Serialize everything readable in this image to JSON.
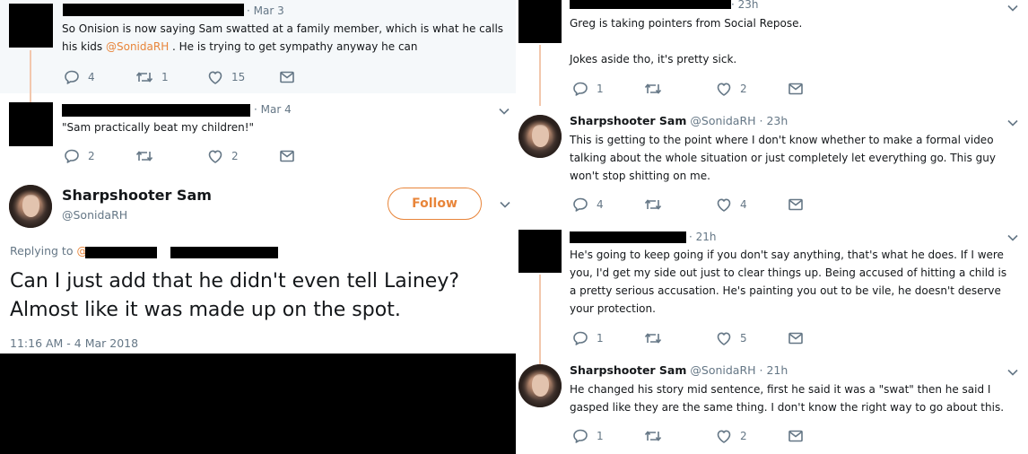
{
  "left": {
    "tweet1": {
      "time": "· Mar 3",
      "text_line1": "So Onision is now saying Sam swatted at a family member, which is what he calls",
      "text_line2_pre": "his kids ",
      "mention": "@SonidaRH",
      "text_line2_post": " . He is trying to get sympathy anyway he can",
      "replies": "4",
      "retweets": "1",
      "likes": "15"
    },
    "tweet2": {
      "time": "· Mar 4",
      "text": "\"Sam practically beat my children!\"",
      "replies": "2",
      "likes": "2"
    },
    "main_tweet": {
      "name": "Sharpshooter Sam",
      "handle": "@SonidaRH",
      "follow_label": "Follow",
      "replying_to": "Replying to",
      "text_line1": "Can I just add that he didn't even tell Lainey?",
      "text_line2": "Almost like it was made up on the spot.",
      "timestamp": "11:16 AM - 4 Mar 2018"
    }
  },
  "right": {
    "r1": {
      "time": "· 23h",
      "text_line1": "Greg is taking pointers from Social Repose.",
      "text_line2": "Jokes aside tho, it's pretty sick.",
      "replies": "1",
      "likes": "2"
    },
    "r2": {
      "name": "Sharpshooter Sam",
      "handle": "@SonidaRH · 23h",
      "line1": "This is getting to the point where I don't know whether to make a formal video",
      "line2": "talking about the whole situation or just completely let everything go. This guy",
      "line3": "won't stop shitting on me.",
      "replies": "4",
      "likes": "4"
    },
    "r3": {
      "time": "· 21h",
      "line1": "He's going to keep going if you don't say anything, that's what he does. If I were",
      "line2": "you, I'd get my side out just to clear things up. Being accused of hitting a child is",
      "line3": "a pretty serious accusation. He's painting you out to be vile, he doesn't deserve",
      "line4": "your protection.",
      "replies": "1",
      "likes": "5"
    },
    "r4": {
      "name": "Sharpshooter Sam",
      "handle": "@SonidaRH · 21h",
      "line1": "He changed his story mid sentence, first he said it was a \"swat\" then he said I",
      "line2": "gasped like they are the same thing. I don't know the right way to go about this.",
      "replies": "1",
      "likes": "2"
    }
  },
  "icons": {
    "reply": "reply-icon",
    "retweet": "retweet-icon",
    "like": "heart-icon",
    "dm": "envelope-icon",
    "caret": "chevron-down-icon"
  },
  "colors": {
    "accent": "#e8853a",
    "muted": "#657786",
    "thread": "#f2c7ad"
  }
}
